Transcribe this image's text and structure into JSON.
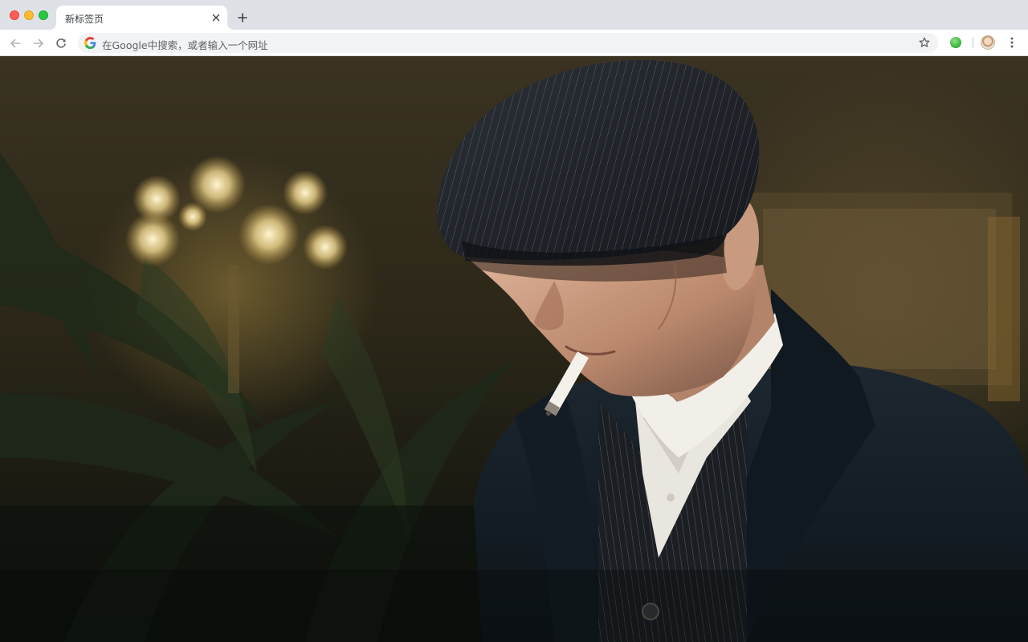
{
  "window": {
    "traffic_lights": [
      "close",
      "minimize",
      "maximize"
    ]
  },
  "tab": {
    "title": "新标签页",
    "close_icon": "close-icon"
  },
  "new_tab": {
    "icon": "plus-icon"
  },
  "toolbar": {
    "back_icon": "back-arrow-icon",
    "forward_icon": "forward-arrow-icon",
    "reload_icon": "reload-icon",
    "omnibox_placeholder": "在Google中搜索，或者输入一个网址",
    "bookmark_icon": "star-icon",
    "extension_icon": "green-circle-icon",
    "profile_icon": "avatar",
    "menu_icon": "kebab-menu-icon"
  },
  "colors": {
    "tabstrip_bg": "#dee1e6",
    "toolbar_bg": "#ffffff",
    "omnibox_bg": "#f1f3f4",
    "close": "#ff5f57",
    "minimize": "#febc2e",
    "maximize": "#28c840"
  },
  "background": {
    "description_icon": "wallpaper-photo"
  }
}
